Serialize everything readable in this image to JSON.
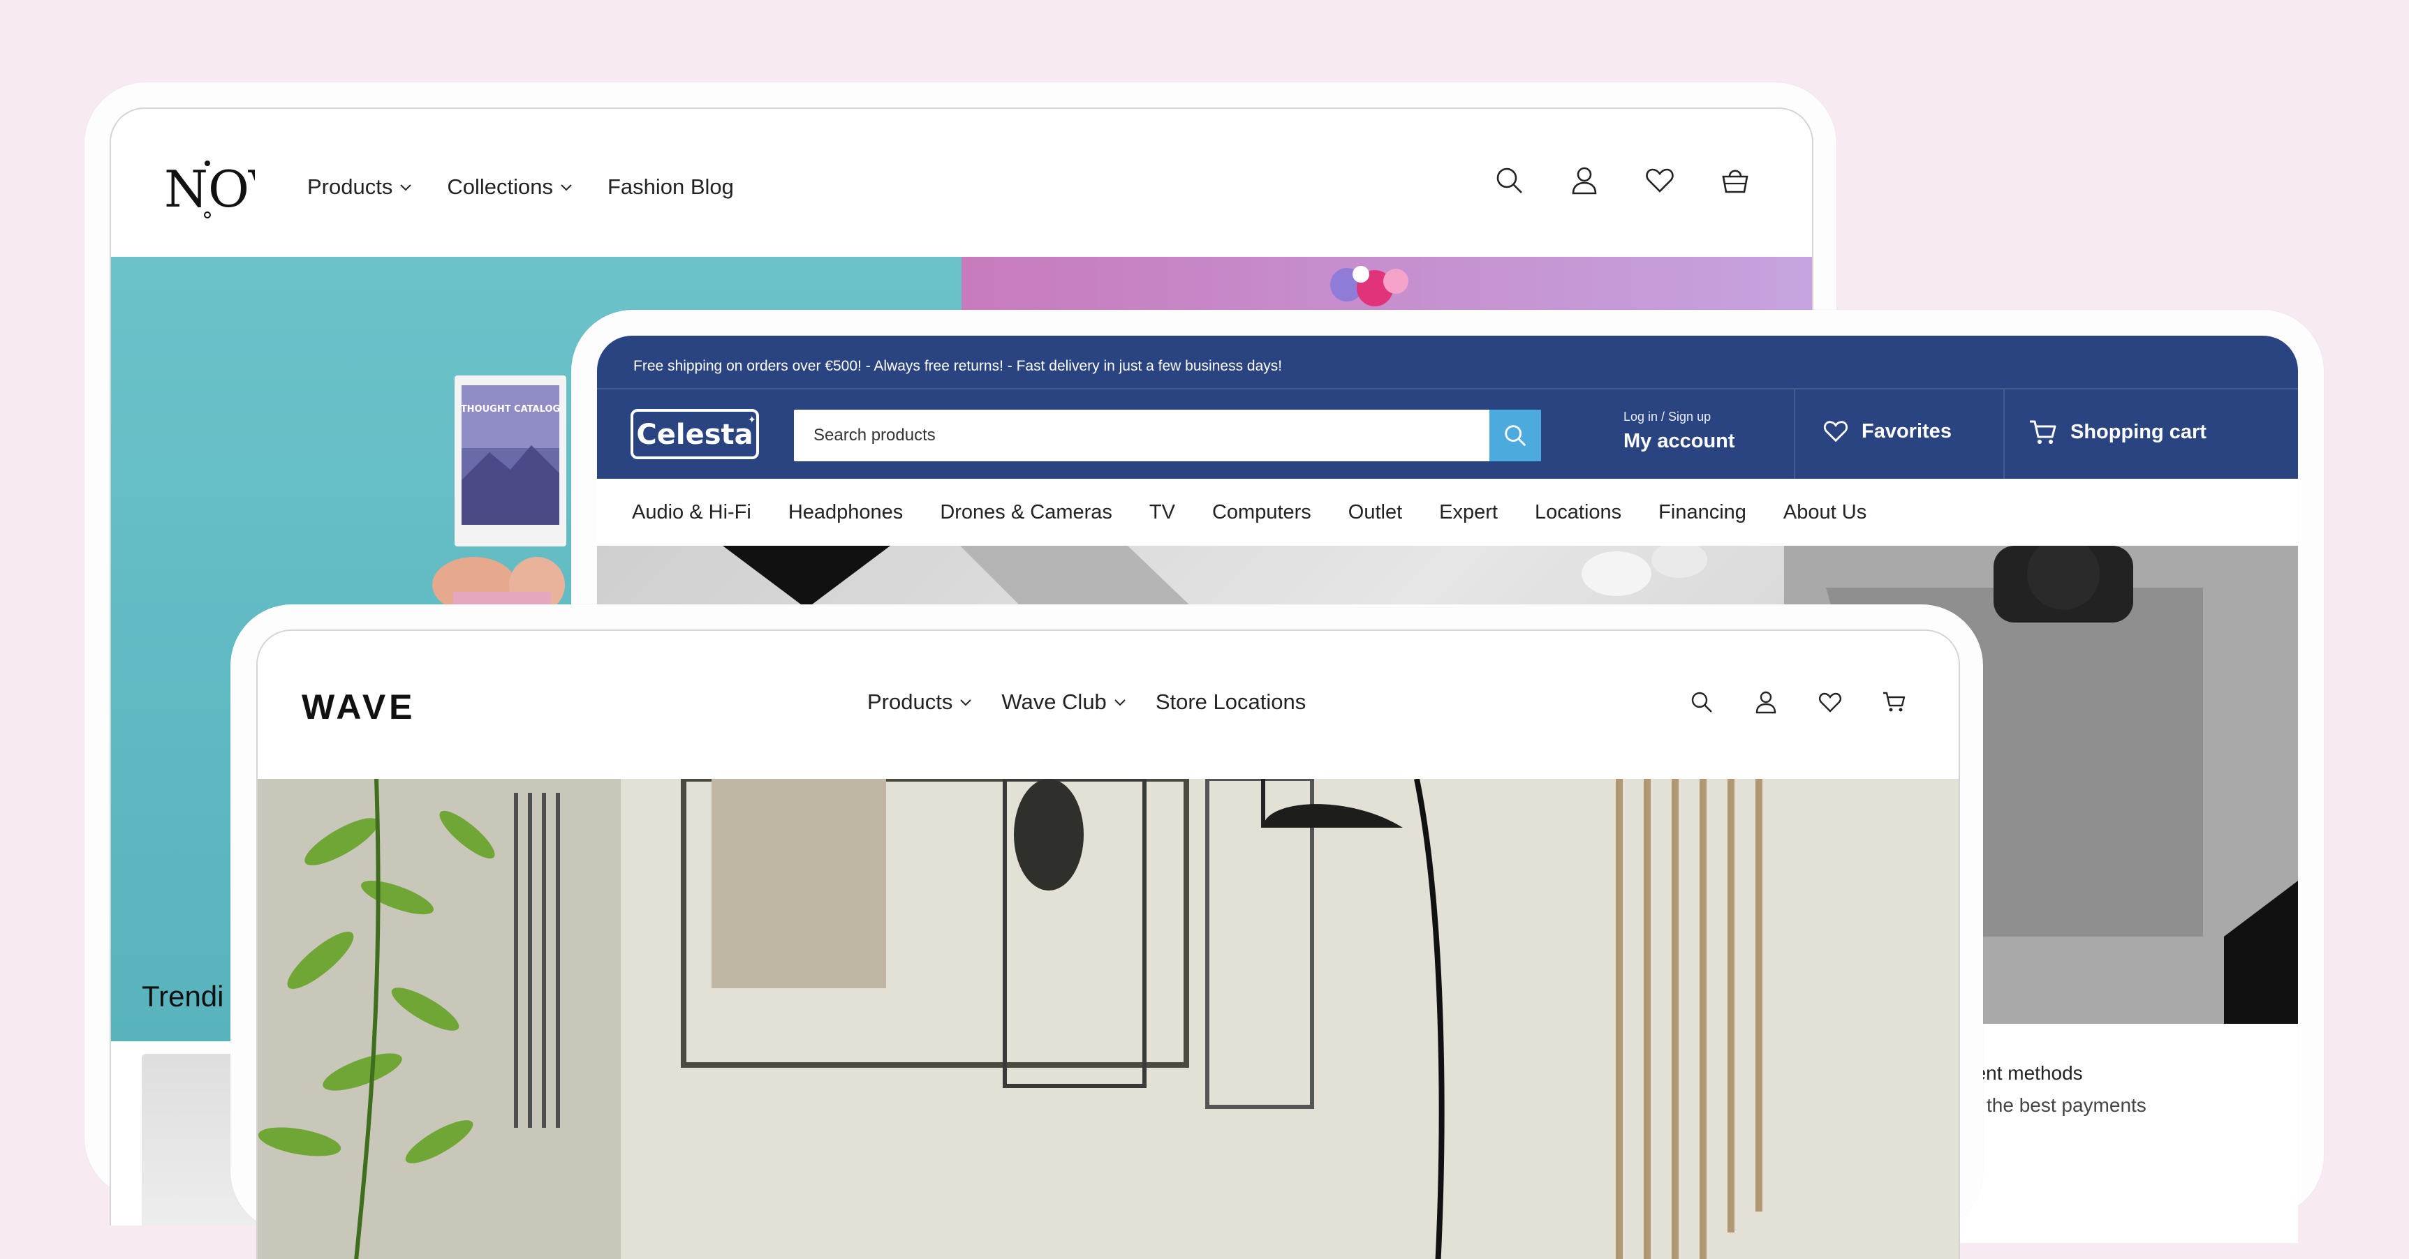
{
  "nova": {
    "logo": "NOVA",
    "nav": [
      {
        "label": "Products",
        "dropdown": true
      },
      {
        "label": "Collections",
        "dropdown": true
      },
      {
        "label": "Fashion Blog",
        "dropdown": false
      }
    ],
    "icons": [
      "search-icon",
      "user-icon",
      "heart-icon",
      "basket-icon"
    ],
    "trending": "Trendi",
    "magazine_title": "THOUGHT CATALOG"
  },
  "celesta": {
    "shipping_banner": "Free shipping on orders over €500! - Always free returns! - Fast delivery in just a few business days!",
    "logo": "Celesta",
    "search_placeholder": "Search products",
    "login_label": "Log in / Sign up",
    "account_label": "My account",
    "favorites_label": "Favorites",
    "cart_label": "Shopping cart",
    "categories": [
      "Audio & Hi-Fi",
      "Headphones",
      "Drones & Cameras",
      "TV",
      "Computers",
      "Outlet",
      "Expert",
      "Locations",
      "Financing",
      "About Us"
    ],
    "below_title": "nent methods",
    "below_text": "the best payments",
    "colors": {
      "primary": "#2a4481",
      "search_button": "#4daadc"
    }
  },
  "wave": {
    "logo": "WAVE",
    "nav": [
      {
        "label": "Products",
        "dropdown": true
      },
      {
        "label": "Wave Club",
        "dropdown": true
      },
      {
        "label": "Store Locations",
        "dropdown": false
      }
    ],
    "icons": [
      "search-icon",
      "user-icon",
      "heart-icon",
      "cart-icon"
    ]
  },
  "colors": {
    "page_background": "#f8eaf2"
  }
}
